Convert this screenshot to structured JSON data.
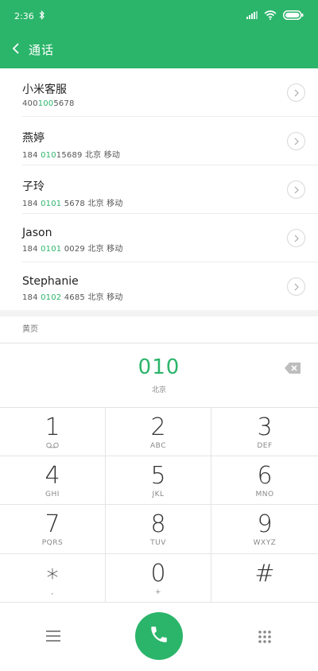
{
  "status_bar": {
    "time": "2:36"
  },
  "header": {
    "title": "通话"
  },
  "contacts": [
    {
      "name": "小米客服",
      "detail_pre": "400",
      "detail_hl": "100",
      "detail_post": "5678"
    },
    {
      "name": "燕婷",
      "detail_pre": "184 ",
      "detail_hl": "010",
      "detail_post": "15689  北京 移动"
    },
    {
      "name": "子玲",
      "detail_pre": "184 ",
      "detail_hl": "0101",
      "detail_post": " 5678  北京 移动"
    },
    {
      "name": "Jason",
      "detail_pre": "184 ",
      "detail_hl": "0101",
      "detail_post": " 0029  北京 移动"
    },
    {
      "name": "Stephanie",
      "detail_pre": "184 ",
      "detail_hl": "0102",
      "detail_post": " 4685  北京 移动"
    }
  ],
  "section": {
    "yellow_pages": "黄页"
  },
  "dial": {
    "number": "010",
    "location": "北京"
  },
  "keypad": [
    {
      "digit": "1",
      "letters": ""
    },
    {
      "digit": "2",
      "letters": "ABC"
    },
    {
      "digit": "3",
      "letters": "DEF"
    },
    {
      "digit": "4",
      "letters": "GHI"
    },
    {
      "digit": "5",
      "letters": "JKL"
    },
    {
      "digit": "6",
      "letters": "MNO"
    },
    {
      "digit": "7",
      "letters": "PQRS"
    },
    {
      "digit": "8",
      "letters": "TUV"
    },
    {
      "digit": "9",
      "letters": "WXYZ"
    },
    {
      "digit": "∗",
      "letters": ","
    },
    {
      "digit": "0",
      "letters": "+"
    },
    {
      "digit": "#",
      "letters": ""
    }
  ],
  "icons": {
    "back": "chevron-left-icon",
    "call": "phone-icon",
    "menu": "menu-icon",
    "dialpad": "dialpad-icon",
    "backspace": "backspace-icon",
    "info": "chevron-right-icon",
    "voicemail": "voicemail-icon"
  },
  "colors": {
    "accent": "#2bb56a",
    "divider": "#e4e4e4"
  }
}
